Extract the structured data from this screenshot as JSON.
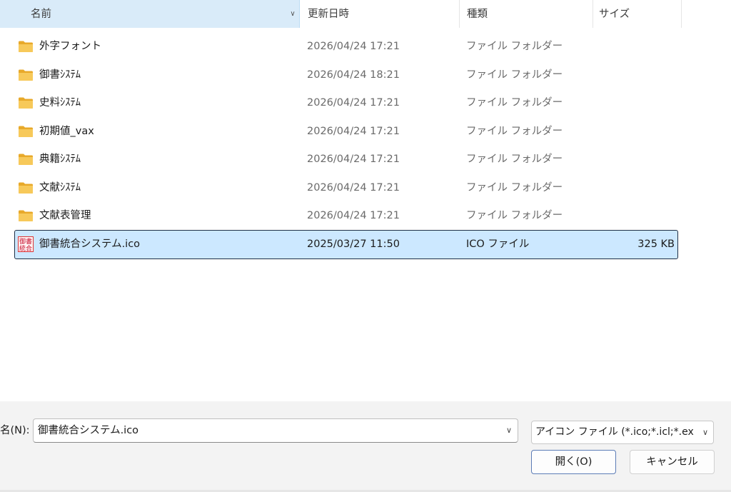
{
  "columns": {
    "name": "名前",
    "date": "更新日時",
    "type": "種類",
    "size": "サイズ"
  },
  "sort_indicator": "^",
  "files": [
    {
      "name": "外字フォント",
      "date": "2026/04/24 17:21",
      "type": "ファイル フォルダー",
      "size": "",
      "icon": "folder-icon"
    },
    {
      "name": "御書ｼｽﾃﾑ",
      "date": "2026/04/24 18:21",
      "type": "ファイル フォルダー",
      "size": "",
      "icon": "folder-icon"
    },
    {
      "name": "史料ｼｽﾃﾑ",
      "date": "2026/04/24 17:21",
      "type": "ファイル フォルダー",
      "size": "",
      "icon": "folder-icon"
    },
    {
      "name": "初期値_vax",
      "date": "2026/04/24 17:21",
      "type": "ファイル フォルダー",
      "size": "",
      "icon": "folder-icon"
    },
    {
      "name": "典籍ｼｽﾃﾑ",
      "date": "2026/04/24 17:21",
      "type": "ファイル フォルダー",
      "size": "",
      "icon": "folder-icon"
    },
    {
      "name": "文献ｼｽﾃﾑ",
      "date": "2026/04/24 17:21",
      "type": "ファイル フォルダー",
      "size": "",
      "icon": "folder-icon"
    },
    {
      "name": "文献表管理",
      "date": "2026/04/24 17:21",
      "type": "ファイル フォルダー",
      "size": "",
      "icon": "folder-icon"
    },
    {
      "name": "御書統合システム.ico",
      "date": "2025/03/27 11:50",
      "type": "ICO ファイル",
      "size": "325 KB",
      "icon": "ico-file-icon",
      "icon_text": "御書統合",
      "selected": true
    }
  ],
  "bottom": {
    "filename_label": "名(N):",
    "filename_value": "御書統合システム.ico",
    "filetype_value": "アイコン ファイル (*.ico;*.icl;*.exe;*.",
    "open_label": "開く(O)",
    "cancel_label": "キャンセル"
  },
  "colors": {
    "header_highlight": "#d9ebf9",
    "selection": "#cce8ff",
    "folder": "#f4c04e",
    "ico_red": "#c8102e"
  }
}
